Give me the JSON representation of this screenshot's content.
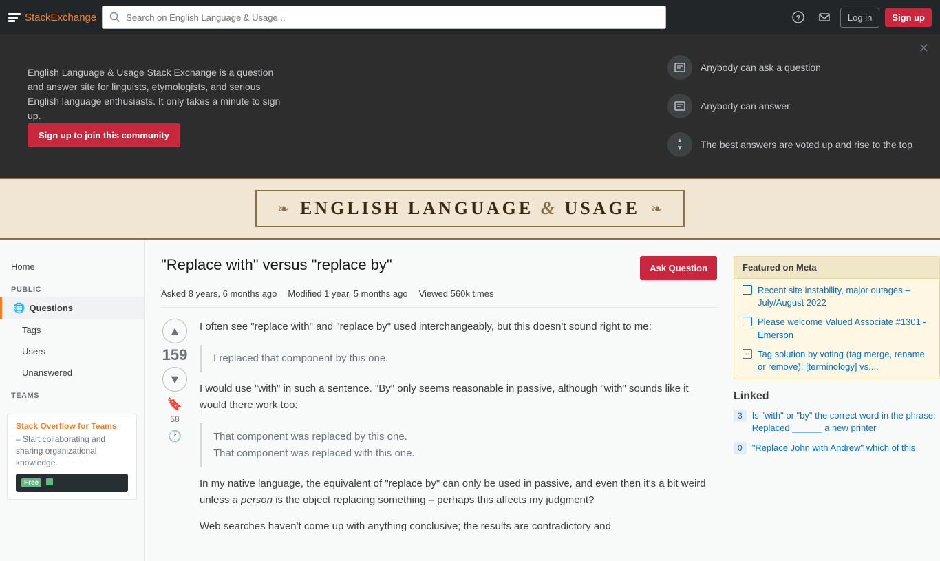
{
  "nav": {
    "logo_text_plain": "Stack",
    "logo_text_accent": "Exchange",
    "search_placeholder": "Search on English Language & Usage...",
    "help_label": "?",
    "login_label": "Log in",
    "signup_label": "Sign up"
  },
  "hero": {
    "description": "English Language & Usage Stack Exchange is a question and answer site for linguists, etymologists, and serious English language enthusiasts. It only takes a minute to sign up.",
    "signup_button": "Sign up to join this community",
    "feature1": "Anybody can ask a question",
    "feature2": "Anybody can answer",
    "feature3": "The best answers are voted up and rise to the top"
  },
  "site_header": {
    "ornament_left": "❧",
    "title_part1": "ENGLISH LANGUAGE",
    "ampersand": "&",
    "title_part2": "USAGE",
    "ornament_right": "❧"
  },
  "sidebar": {
    "home": "Home",
    "public_label": "PUBLIC",
    "questions_label": "Questions",
    "tags_label": "Tags",
    "users_label": "Users",
    "unanswered_label": "Unanswered",
    "teams_label": "TEAMS",
    "teams_title_plain": "Stack Overflow for",
    "teams_title_accent": "Teams",
    "teams_description": "– Start collaborating and sharing organizational knowledge.",
    "teams_cta_label": "Free"
  },
  "question": {
    "title": "\"Replace with\" versus \"replace by\"",
    "ask_button": "Ask Question",
    "asked_label": "Asked",
    "asked_value": "8 years, 6 months ago",
    "modified_label": "Modified",
    "modified_value": "1 year, 5 months ago",
    "viewed_label": "Viewed",
    "viewed_value": "560k times",
    "vote_count": "159",
    "bookmark_count": "58",
    "body_p1": "I often see \"replace with\" and \"replace by\" used interchangeably, but this doesn't sound right to me:",
    "blockquote1": "I replaced that component by this one.",
    "body_p2": "I would use \"with\" in such a sentence. \"By\" only seems reasonable in passive, although \"with\" sounds like it would there work too:",
    "blockquote2_line1": "That component was replaced by this one.",
    "blockquote2_line2": "That component was replaced with this one.",
    "body_p3": "In my native language, the equivalent of \"replace by\" can only be used in passive, and even then it's a bit weird unless a person is the object replacing something – perhaps this affects my judgment?",
    "body_p4": "Web searches haven't come up with anything conclusive; the results are contradictory and"
  },
  "featured_meta": {
    "title": "Featured on Meta",
    "items": [
      {
        "text": "Recent site instability, major outages – July/August 2022",
        "type": "square"
      },
      {
        "text": "Please welcome Valued Associate #1301 - Emerson",
        "type": "square"
      },
      {
        "text": "Tag solution by voting (tag merge, rename or remove): [terminology] vs....",
        "type": "meta"
      }
    ]
  },
  "linked": {
    "title": "Linked",
    "items": [
      {
        "count": "3",
        "text": "Is \"with\" or \"by\" the correct word in the phrase: Replaced ______ a new printer"
      },
      {
        "count": "0",
        "text": "\"Replace John with Andrew\" which of this"
      }
    ]
  }
}
